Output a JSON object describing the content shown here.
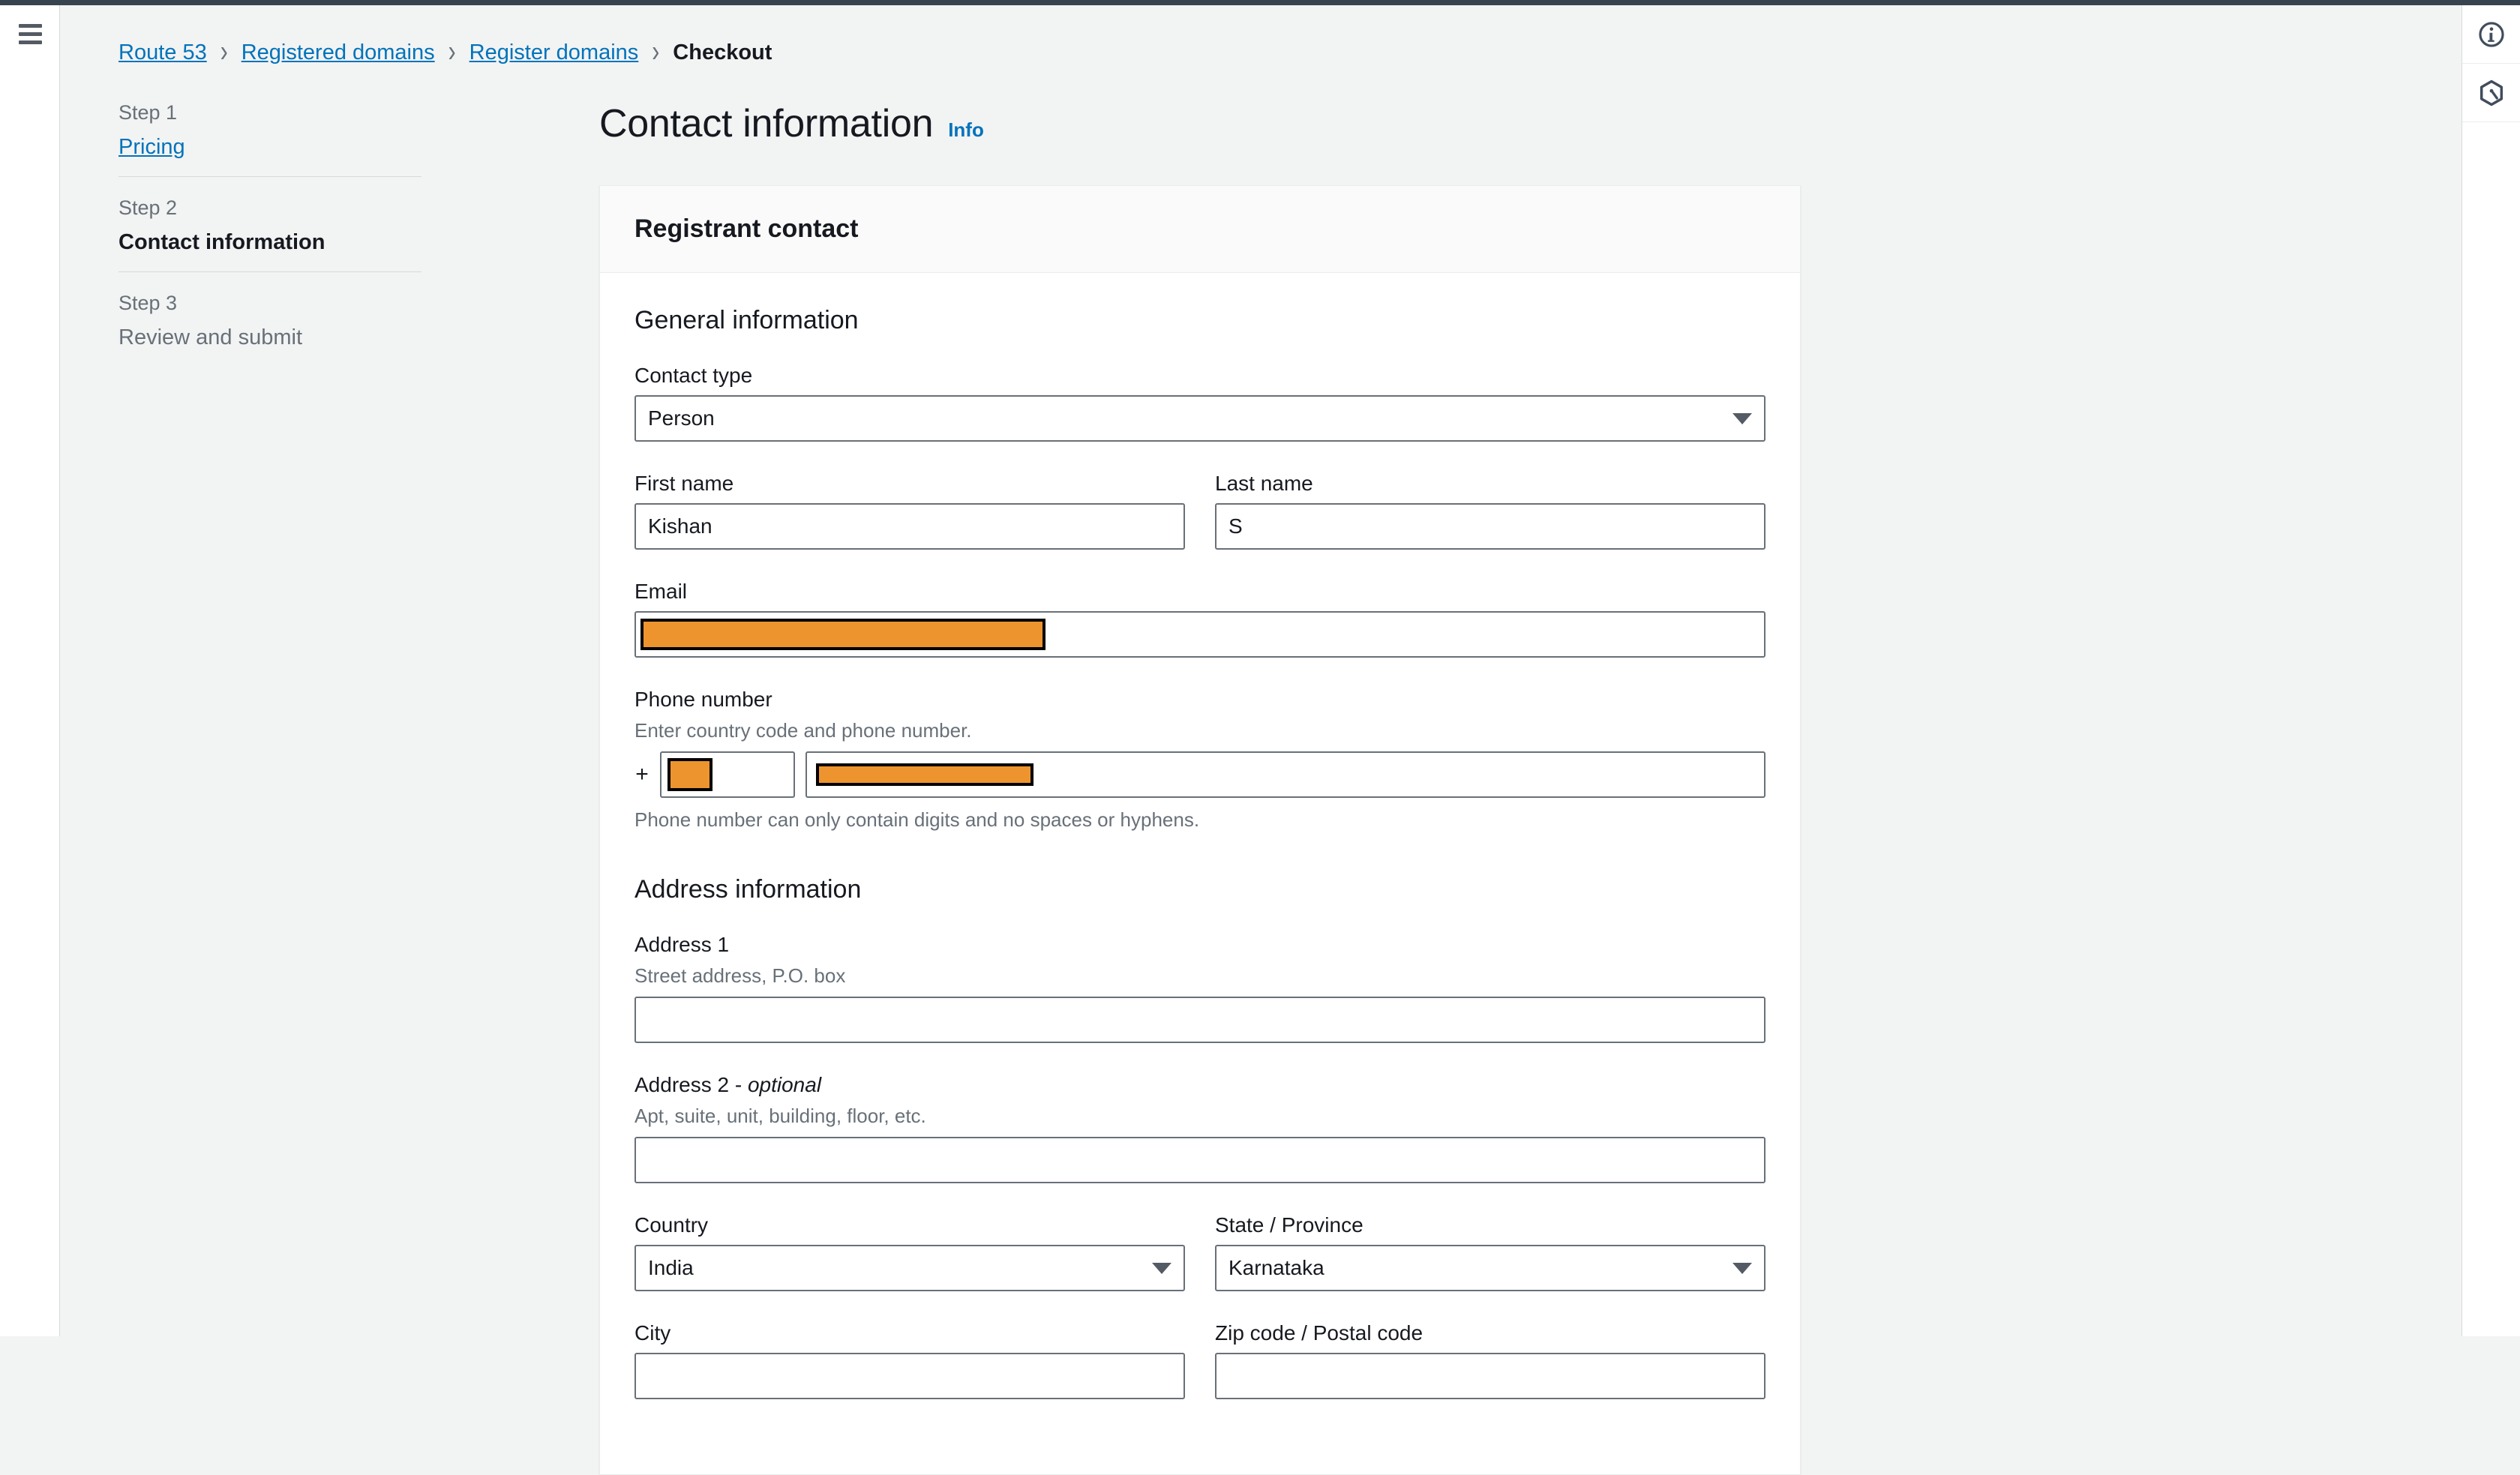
{
  "chrome": {
    "menu_icon": "hamburger-icon",
    "right_icons": [
      {
        "name": "info-circle-icon",
        "label": "Info panel"
      },
      {
        "name": "amazon-q-hexagon-icon",
        "label": "Amazon Q"
      }
    ]
  },
  "breadcrumb": {
    "items": [
      {
        "label": "Route 53",
        "link": true
      },
      {
        "label": "Registered domains",
        "link": true
      },
      {
        "label": "Register domains",
        "link": true
      },
      {
        "label": "Checkout",
        "link": false
      }
    ],
    "separator": "›"
  },
  "wizard": {
    "steps": [
      {
        "number": "Step 1",
        "title": "Pricing",
        "state": "link"
      },
      {
        "number": "Step 2",
        "title": "Contact information",
        "state": "active"
      },
      {
        "number": "Step 3",
        "title": "Review and submit",
        "state": "inactive"
      }
    ]
  },
  "page": {
    "title": "Contact information",
    "info_label": "Info"
  },
  "card": {
    "header_title": "Registrant contact",
    "general": {
      "section_title": "General information",
      "contact_type": {
        "label": "Contact type",
        "value": "Person"
      },
      "first_name": {
        "label": "First name",
        "value": "Kishan"
      },
      "last_name": {
        "label": "Last name",
        "value": "S"
      },
      "email": {
        "label": "Email",
        "value": "",
        "redacted": true
      },
      "phone": {
        "label": "Phone number",
        "description": "Enter country code and phone number.",
        "hint": "Phone number can only contain digits and no spaces or hyphens.",
        "prefix": "+",
        "country_code": "",
        "number": "",
        "redacted": true
      }
    },
    "address": {
      "section_title": "Address information",
      "address1": {
        "label": "Address 1",
        "description": "Street address, P.O. box",
        "value": ""
      },
      "address2": {
        "label": "Address 2 - ",
        "label_optional": "optional",
        "description": "Apt, suite, unit, building, floor, etc.",
        "value": ""
      },
      "country": {
        "label": "Country",
        "value": "India"
      },
      "state": {
        "label": "State / Province",
        "value": "Karnataka"
      },
      "city": {
        "label": "City",
        "value": ""
      },
      "zip": {
        "label": "Zip code / Postal code",
        "value": ""
      }
    }
  },
  "colors": {
    "link": "#0073bb",
    "redaction": "#ee942f",
    "page_bg": "#f2f3f3",
    "top_strip": "#37444f"
  }
}
